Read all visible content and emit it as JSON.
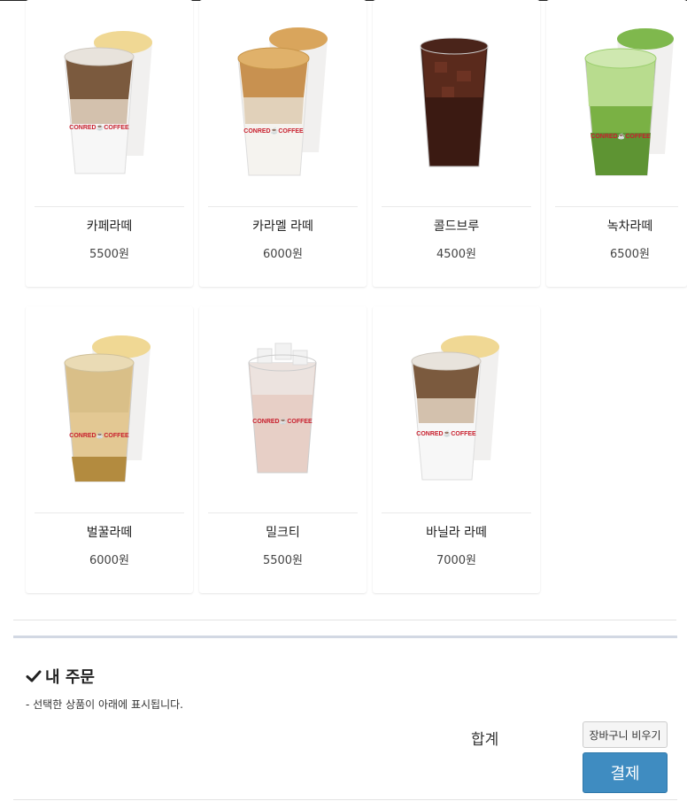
{
  "menu": {
    "items": [
      {
        "name": "카페라떼",
        "price": "5500원",
        "image": "iced-latte-cup"
      },
      {
        "name": "카라멜 라떼",
        "price": "6000원",
        "image": "iced-caramel-latte-cup"
      },
      {
        "name": "콜드브루",
        "price": "4500원",
        "image": "iced-cold-brew-cup"
      },
      {
        "name": "녹차라떼",
        "price": "6500원",
        "image": "iced-green-tea-latte-cup"
      },
      {
        "name": "벌꿀라떼",
        "price": "6000원",
        "image": "iced-honey-latte-cup"
      },
      {
        "name": "밀크티",
        "price": "5500원",
        "image": "iced-milk-tea-cup"
      },
      {
        "name": "바닐라 라떼",
        "price": "7000원",
        "image": "iced-vanilla-latte-cup"
      }
    ]
  },
  "cup_brand": "CONRED COFFEE",
  "order": {
    "title": "내 주문",
    "icon": "check-icon",
    "description": "- 선택한 상품이 아래에 표시됩니다.",
    "sum_label": "합계",
    "empty_cart_label": "장바구니 비우기",
    "pay_label": "결제"
  },
  "colors": {
    "pay_button": "#3f8cc1",
    "panel_border": "#d2d8e3",
    "brand_red": "#c8202e"
  }
}
